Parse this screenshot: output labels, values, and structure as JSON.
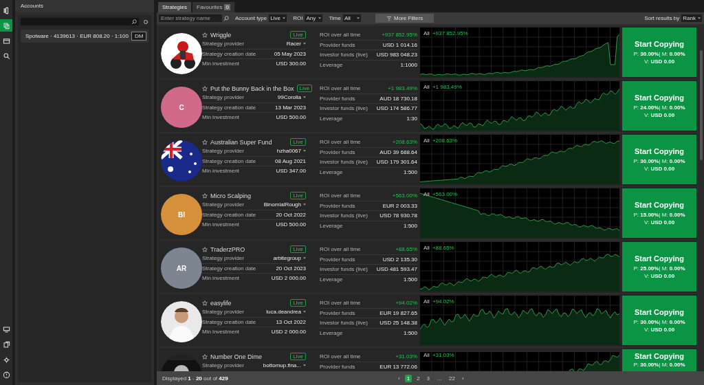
{
  "rail": {
    "top_icons": [
      {
        "selected": false
      },
      {
        "selected": true
      },
      {
        "selected": false
      },
      {
        "selected": false
      }
    ],
    "bottom_icons": [
      {
        "selected": false
      },
      {
        "selected": false
      },
      {
        "selected": false
      },
      {
        "selected": false
      }
    ]
  },
  "accounts": {
    "title": "Accounts",
    "account": {
      "text": "Spotware · 4139613 · EUR 808.20 · 1:100",
      "badge": "DM"
    }
  },
  "tabs": [
    {
      "label": "Strategies",
      "selected": true
    },
    {
      "label": "Favourites",
      "count": "0",
      "selected": false
    }
  ],
  "filters": {
    "search": {
      "placeholder": "Enter strategy name"
    },
    "selects": [
      {
        "label": "Account type",
        "value": "Live"
      },
      {
        "label": "ROI",
        "value": "Any"
      },
      {
        "label": "Time",
        "value": "All"
      }
    ],
    "more": "More Filters",
    "sort": {
      "label": "Sort results by",
      "value": "Rank"
    }
  },
  "strategies": [
    {
      "name": "Wriggle",
      "status": "Live",
      "avatar": {
        "kind": "picture"
      },
      "left": [
        {
          "label": "Strategy provider",
          "value": "Racer",
          "dropdown": true
        },
        {
          "label": "Strategy creation date",
          "value": "05 May 2023"
        },
        {
          "label": "Min investment",
          "value": "USD 300.00"
        }
      ],
      "right": [
        {
          "label": "ROI over all time",
          "value": "+937 852.95%",
          "positive": true
        },
        {
          "label": "Provider funds",
          "value": "USD 1 014.16"
        },
        {
          "label": "Investor funds (live)",
          "value": "USD 983 048.23"
        },
        {
          "label": "Leverage",
          "value": "1:1000"
        }
      ],
      "chart": {
        "period": "All",
        "roi": "+937 852.95%"
      },
      "copy": {
        "title": "Start Copying",
        "line1": "P: **30.00%**| M: **0.00%**",
        "line2": "V: **USD 0.00**"
      }
    },
    {
      "name": "Put the Bunny Back in the Box",
      "status": "Live",
      "avatar": {
        "kind": "initials",
        "text": "C",
        "color": "#d0698a"
      },
      "left": [
        {
          "label": "Strategy provider",
          "value": "99Corolla",
          "dropdown": true
        },
        {
          "label": "Strategy creation date",
          "value": "13 Mar 2023"
        },
        {
          "label": "Min investment",
          "value": "USD 500.00"
        }
      ],
      "right": [
        {
          "label": "ROI over all time",
          "value": "+1 983.49%",
          "positive": true
        },
        {
          "label": "Provider funds",
          "value": "AUD 18 730.18"
        },
        {
          "label": "Investor funds (live)",
          "value": "USD 174 586.77"
        },
        {
          "label": "Leverage",
          "value": "1:30"
        }
      ],
      "chart": {
        "period": "All",
        "roi": "+1 983.49%"
      },
      "copy": {
        "title": "Start Copying",
        "line1": "P: **24.00%**| M: **0.00%**",
        "line2": "V: **USD 0.00**"
      }
    },
    {
      "name": "Australian Super Fund",
      "status": "Live",
      "avatar": {
        "kind": "picture"
      },
      "left": [
        {
          "label": "Strategy provider",
          "value": "hzha0067",
          "dropdown": true
        },
        {
          "label": "Strategy creation date",
          "value": "08 Aug 2021"
        },
        {
          "label": "Min investment",
          "value": "USD 347.00"
        }
      ],
      "right": [
        {
          "label": "ROI over all time",
          "value": "+208.63%",
          "positive": true
        },
        {
          "label": "Provider funds",
          "value": "AUD 39 688.64"
        },
        {
          "label": "Investor funds (live)",
          "value": "USD 179 301.64"
        },
        {
          "label": "Leverage",
          "value": "1:500"
        }
      ],
      "chart": {
        "period": "All",
        "roi": "+208.63%"
      },
      "copy": {
        "title": "Start Copying",
        "line1": "P: **30.00%**| M: **0.00%**",
        "line2": "V: **USD 0.00**"
      }
    },
    {
      "name": "Micro Scalping",
      "status": "Live",
      "avatar": {
        "kind": "initials",
        "text": "BI",
        "color": "#d68f3a"
      },
      "left": [
        {
          "label": "Strategy provider",
          "value": "BinomialRough",
          "dropdown": true
        },
        {
          "label": "Strategy creation date",
          "value": "20 Oct 2022"
        },
        {
          "label": "Min investment",
          "value": "USD 500.00"
        }
      ],
      "right": [
        {
          "label": "ROI over all time",
          "value": "+563.00%",
          "positive": true
        },
        {
          "label": "Provider funds",
          "value": "EUR 2 003.33"
        },
        {
          "label": "Investor funds (live)",
          "value": "USD 78 930.78"
        },
        {
          "label": "Leverage",
          "value": "1:500"
        }
      ],
      "chart": {
        "period": "All",
        "roi": "+563.00%"
      },
      "copy": {
        "title": "Start Copying",
        "line1": "P: **15.00%**| M: **0.00%**",
        "line2": "V: **USD 0.00**"
      }
    },
    {
      "name": "TraderzPRO",
      "status": "Live",
      "avatar": {
        "kind": "initials",
        "text": "AR",
        "color": "#7d8591"
      },
      "left": [
        {
          "label": "Strategy provider",
          "value": "arbitegroup",
          "dropdown": true
        },
        {
          "label": "Strategy creation date",
          "value": "20 Oct 2023"
        },
        {
          "label": "Min investment",
          "value": "USD 2 000.00"
        }
      ],
      "right": [
        {
          "label": "ROI over all time",
          "value": "+88.65%",
          "positive": true
        },
        {
          "label": "Provider funds",
          "value": "USD 2 135.30"
        },
        {
          "label": "Investor funds (live)",
          "value": "USD 481 593.47"
        },
        {
          "label": "Leverage",
          "value": "1:500"
        }
      ],
      "chart": {
        "period": "All",
        "roi": "+88.65%"
      },
      "copy": {
        "title": "Start Copying",
        "line1": "P: **25.00%**| M: **0.00%**",
        "line2": "V: **USD 0.00**"
      }
    },
    {
      "name": "easylife",
      "status": "Live",
      "avatar": {
        "kind": "picture"
      },
      "left": [
        {
          "label": "Strategy provider",
          "value": "luca.deandrea",
          "dropdown": true
        },
        {
          "label": "Strategy creation date",
          "value": "13 Oct 2022"
        },
        {
          "label": "Min investment",
          "value": "USD 2 000.00"
        }
      ],
      "right": [
        {
          "label": "ROI over all time",
          "value": "+94.02%",
          "positive": true
        },
        {
          "label": "Provider funds",
          "value": "EUR 19 827.65"
        },
        {
          "label": "Investor funds (live)",
          "value": "USD 25 148.38"
        },
        {
          "label": "Leverage",
          "value": "1:500"
        }
      ],
      "chart": {
        "period": "All",
        "roi": "+94.02%"
      },
      "copy": {
        "title": "Start Copying",
        "line1": "P: **30.00%**| M: **0.00%**",
        "line2": "V: **USD 0.00**"
      }
    },
    {
      "name": "Number One Dime",
      "status": "Live",
      "avatar": {
        "kind": "picture"
      },
      "left": [
        {
          "label": "Strategy provider",
          "value": "bottomup.fina...",
          "dropdown": true
        }
      ],
      "right": [
        {
          "label": "ROI over all time",
          "value": "+31.03%",
          "positive": true
        },
        {
          "label": "Provider funds",
          "value": "EUR 13 772.06"
        }
      ],
      "chart": {
        "period": "All",
        "roi": "+31.03%"
      },
      "copy": {
        "title": "Start Copying",
        "line1": "P: **30.00%**| M: **0.00%**"
      }
    }
  ],
  "footer": {
    "displayed": "Displayed **1** - **20** out of **429**",
    "prev": "‹",
    "pages": [
      {
        "label": "1",
        "selected": true
      },
      {
        "label": "2",
        "selected": false
      },
      {
        "label": "3",
        "selected": false
      },
      {
        "label": "…",
        "selected": false
      },
      {
        "label": "22",
        "selected": false
      }
    ],
    "next": "›"
  }
}
